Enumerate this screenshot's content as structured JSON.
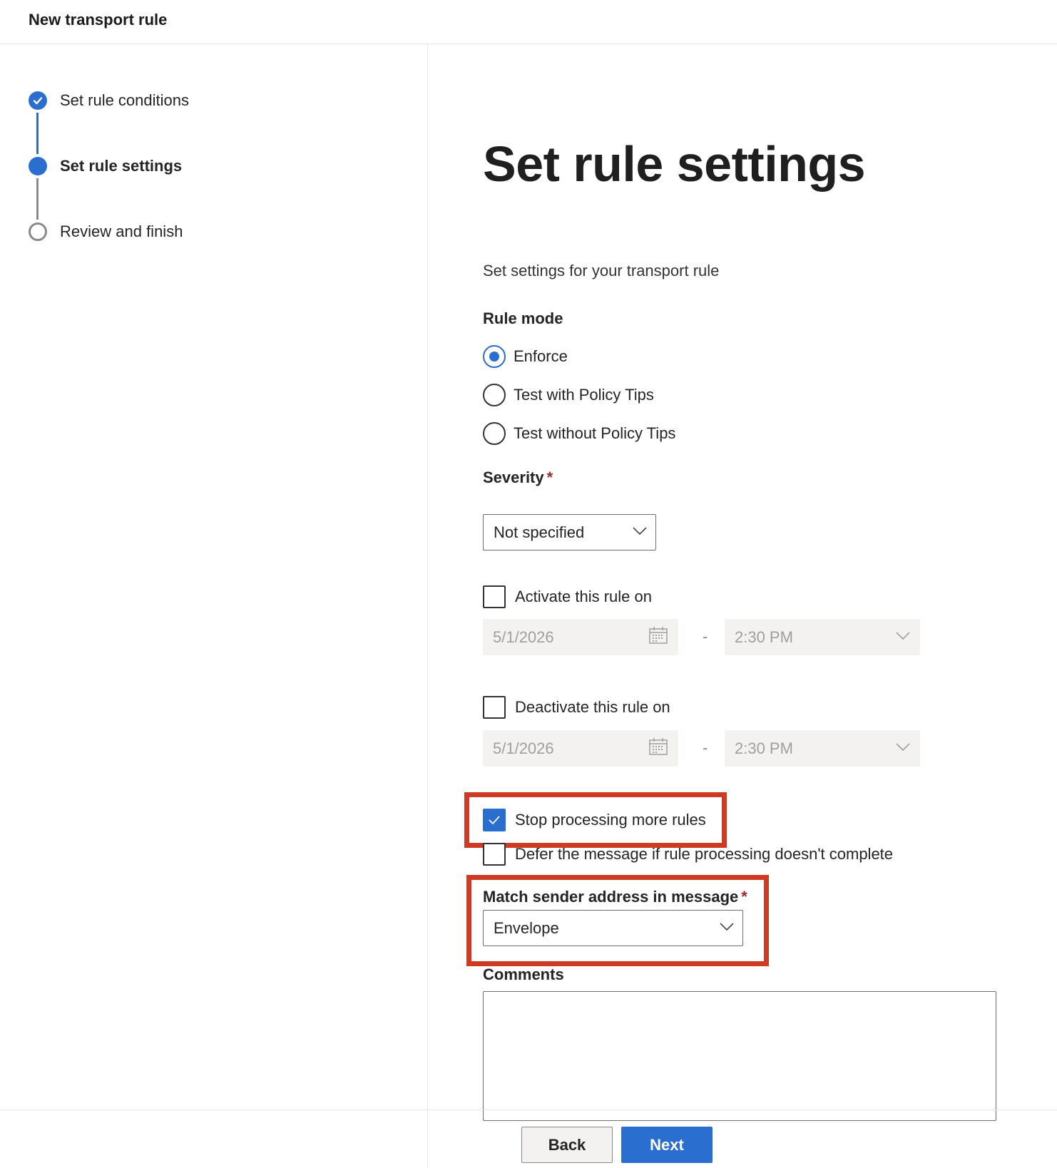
{
  "header": {
    "title": "New transport rule"
  },
  "wizard": {
    "steps": [
      {
        "label": "Set rule conditions",
        "state": "done"
      },
      {
        "label": "Set rule settings",
        "state": "current"
      },
      {
        "label": "Review and finish",
        "state": "pending"
      }
    ]
  },
  "main": {
    "title": "Set rule settings",
    "subtitle": "Set settings for your transport rule",
    "rule_mode": {
      "label": "Rule mode",
      "options": [
        {
          "label": "Enforce",
          "selected": true
        },
        {
          "label": "Test with Policy Tips",
          "selected": false
        },
        {
          "label": "Test without Policy Tips",
          "selected": false
        }
      ]
    },
    "severity": {
      "label": "Severity",
      "required_mark": "*",
      "value": "Not specified"
    },
    "activate": {
      "label": "Activate this rule on",
      "checked": false,
      "date": "5/1/2026",
      "separator": "-",
      "time": "2:30 PM"
    },
    "deactivate": {
      "label": "Deactivate this rule on",
      "checked": false,
      "date": "5/1/2026",
      "separator": "-",
      "time": "2:30 PM"
    },
    "stop_processing": {
      "label": "Stop processing more rules",
      "checked": true
    },
    "defer": {
      "label": "Defer the message if rule processing doesn't complete",
      "checked": false
    },
    "match_sender": {
      "label": "Match sender address in message",
      "required_mark": "*",
      "value": "Envelope"
    },
    "comments": {
      "label": "Comments",
      "value": ""
    }
  },
  "footer": {
    "back_label": "Back",
    "next_label": "Next"
  },
  "colors": {
    "accent": "#2a6fcf",
    "highlight": "#cf3a24",
    "required": "#a4262c"
  }
}
